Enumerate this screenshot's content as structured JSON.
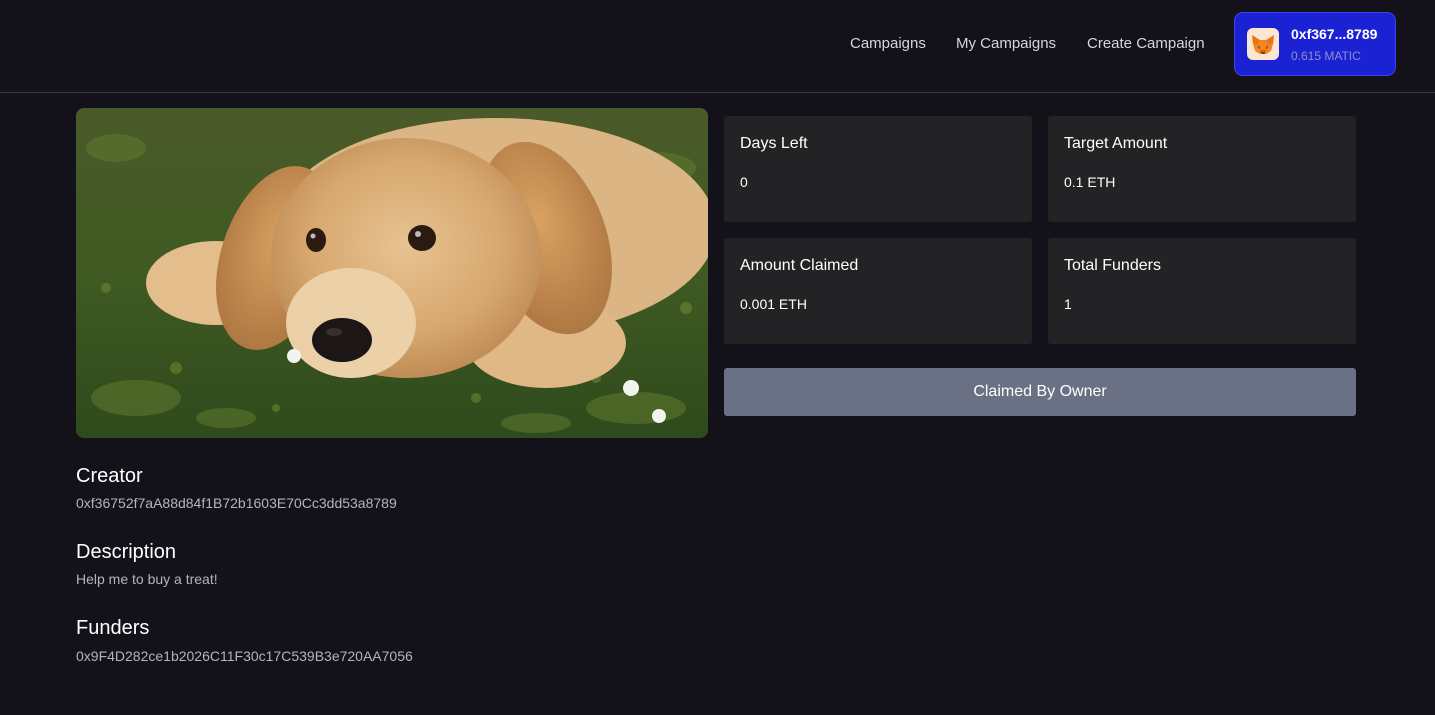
{
  "nav": {
    "links": [
      "Campaigns",
      "My Campaigns",
      "Create Campaign"
    ],
    "wallet": {
      "address": "0xf367...8789",
      "balance": "0.615 MATIC",
      "icon": "metamask-fox-icon"
    }
  },
  "campaign": {
    "image": "golden-retriever-puppy-photo",
    "stats": [
      {
        "label": "Days Left",
        "value": "0"
      },
      {
        "label": "Target Amount",
        "value": "0.1 ETH"
      },
      {
        "label": "Amount Claimed",
        "value": "0.001 ETH"
      },
      {
        "label": "Total Funders",
        "value": "1"
      }
    ],
    "status_button": "Claimed By Owner",
    "creator": {
      "title": "Creator",
      "value": "0xf36752f7aA88d84f1B72b1603E70Cc3dd53a8789"
    },
    "description": {
      "title": "Description",
      "value": "Help me to buy a treat!"
    },
    "funders": {
      "title": "Funders",
      "value": "0x9F4D282ce1b2026C11F30c17C539B3e720AA7056"
    }
  },
  "colors": {
    "background": "#13121b",
    "card": "#232325",
    "wallet_accent": "#1a22d4",
    "claimed_button": "#6b7185"
  }
}
